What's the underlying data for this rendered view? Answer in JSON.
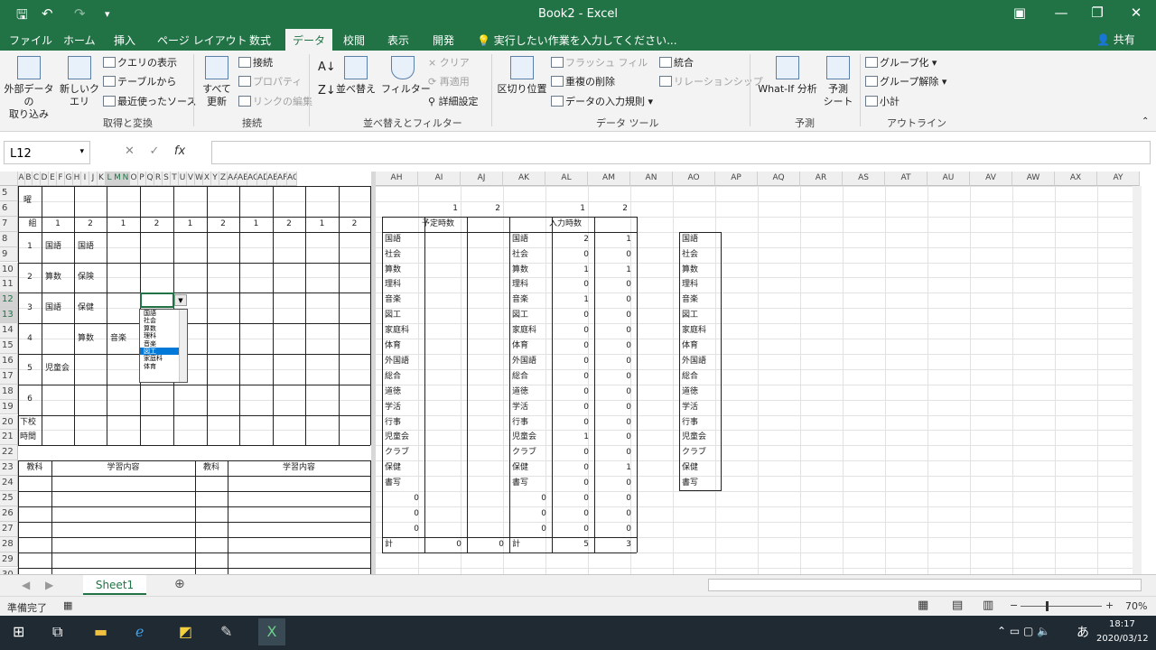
{
  "window": {
    "title": "Book2 - Excel",
    "icons": [
      "save-icon",
      "undo-icon",
      "redo-icon",
      "customize-icon"
    ]
  },
  "tabs": [
    "ファイル",
    "ホーム",
    "挿入",
    "ページ レイアウト",
    "数式",
    "データ",
    "校閲",
    "表示",
    "開発"
  ],
  "active_tab": "データ",
  "tellme": "実行したい作業を入力してください...",
  "share": "共有",
  "ribbon": {
    "get_data": "外部データの\n取り込み",
    "new_query": "新しいク\nエリ",
    "show_queries": "クエリの表示",
    "from_table": "テーブルから",
    "recent_sources": "最近使ったソース",
    "group_get_transform": "取得と変換",
    "refresh_all": "すべて\n更新",
    "connections": "接続",
    "properties": "プロパティ",
    "edit_links": "リンクの編集",
    "group_connections": "接続",
    "sort": "並べ替え",
    "filter": "フィルター",
    "clear": "クリア",
    "reapply": "再適用",
    "advanced": "詳細設定",
    "group_sort_filter": "並べ替えとフィルター",
    "text_to_columns": "区切り位置",
    "flash_fill": "フラッシュ フィル",
    "remove_duplicates": "重複の削除",
    "data_validation": "データの入力規則",
    "consolidate": "統合",
    "relationships": "リレーションシップ",
    "group_data_tools": "データ ツール",
    "whatif": "What-If 分析",
    "forecast_sheet": "予測\nシート",
    "group_forecast": "予測",
    "group": "グループ化",
    "ungroup": "グループ解除",
    "subtotal": "小計",
    "group_outline": "アウトライン"
  },
  "formula_bar": {
    "name_box": "L12",
    "fx": "fx",
    "value": ""
  },
  "left_cols": [
    "A",
    "B",
    "C",
    "D",
    "E",
    "F",
    "G",
    "H",
    "I",
    "J",
    "K",
    "L",
    "M",
    "N",
    "O",
    "P",
    "Q",
    "R",
    "S",
    "T",
    "U",
    "V",
    "W",
    "X",
    "Y",
    "Z",
    "AA",
    "AB",
    "AC",
    "AD",
    "AE",
    "AF",
    "AG"
  ],
  "left_rows": [
    "5",
    "6",
    "7",
    "8",
    "9",
    "10",
    "11",
    "12",
    "13",
    "14",
    "15",
    "16",
    "17",
    "18",
    "19",
    "20",
    "21",
    "22",
    "23",
    "24",
    "25",
    "26",
    "27",
    "28",
    "29",
    "30"
  ],
  "timetable": {
    "corner_top": "曜",
    "header_label": "組",
    "header_values": [
      "1",
      "2",
      "1",
      "2",
      "1",
      "2",
      "1",
      "2",
      "1",
      "2"
    ],
    "periods": [
      "1",
      "2",
      "3",
      "4",
      "5",
      "6"
    ],
    "cells": [
      [
        "国語",
        "国語"
      ],
      [
        "算数",
        "保険"
      ],
      [
        "国語",
        "保健"
      ],
      [
        "",
        "算数",
        "音楽"
      ],
      [
        "児童会"
      ]
    ],
    "dismiss": "下校\n時間",
    "notes_headers": [
      "教科",
      "学習内容",
      "教科",
      "学習内容"
    ]
  },
  "dropdown": {
    "items": [
      "国語",
      "社会",
      "算数",
      "理科",
      "音楽",
      "図工",
      "家庭科",
      "体育"
    ],
    "selected": "図工"
  },
  "right_cols": [
    "AH",
    "AI",
    "AJ",
    "AK",
    "AL",
    "AM",
    "AN",
    "AO",
    "AP",
    "AQ",
    "AR",
    "AS",
    "AT",
    "AU",
    "AV",
    "AW",
    "AX",
    "AY"
  ],
  "right_table": {
    "top_nums": [
      "1",
      "2",
      "1",
      "2"
    ],
    "planned_label": "予定時数",
    "input_label": "入力時数",
    "subjects": [
      "国語",
      "社会",
      "算数",
      "理科",
      "音楽",
      "図工",
      "家庭科",
      "体育",
      "外国語",
      "総合",
      "道徳",
      "学活",
      "行事",
      "児童会",
      "クラブ",
      "保健",
      "書写"
    ],
    "al_values": [
      "2",
      "0",
      "1",
      "0",
      "1",
      "0",
      "0",
      "0",
      "0",
      "0",
      "0",
      "0",
      "0",
      "1",
      "0",
      "0",
      "0"
    ],
    "am_values": [
      "1",
      "0",
      "1",
      "0",
      "0",
      "0",
      "0",
      "0",
      "0",
      "0",
      "0",
      "0",
      "0",
      "0",
      "0",
      "1",
      "0"
    ],
    "zero_rows_ah": [
      "0",
      "0",
      "0"
    ],
    "zero_rows_ak": [
      "0",
      "0",
      "0"
    ],
    "zero_rows_al": [
      "0",
      "0",
      "0"
    ],
    "zero_rows_am": [
      "0",
      "0",
      "0"
    ],
    "total_label": "計",
    "total_ai": "0",
    "total_aj": "0",
    "total_al": "5",
    "total_am": "3"
  },
  "sheet_tab": "Sheet1",
  "status": {
    "ready": "準備完了",
    "zoom": "70%"
  },
  "taskbar": {
    "time": "18:17",
    "date": "2020/03/12",
    "ime": "あ"
  }
}
